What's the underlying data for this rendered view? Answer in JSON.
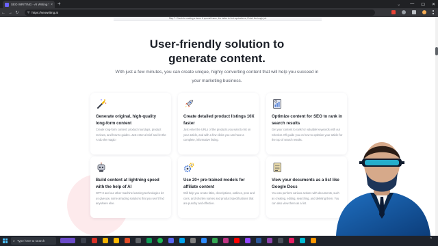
{
  "browser": {
    "tab_title": "SEO WRITING - AI Writing Tool",
    "tab_close": "×",
    "new_tab": "+",
    "window_controls": [
      "—",
      "▢",
      "✕"
    ],
    "dropdown": "⌄",
    "nav": {
      "back": "←",
      "forward": "→",
      "reload": "↻"
    },
    "lock": "⛨",
    "url": "https://seowriting.ai"
  },
  "page": {
    "caption_strip": "Step 7. Check for making a demo & special frame, the better to find equivalence, Finish the tough job",
    "headline_line1": "User-friendly solution to",
    "headline_line2": "generate content.",
    "subtext": "With just a few minutes, you can create unique, highly converting content that will help you succeed in your marketing business."
  },
  "features": [
    {
      "icon": "magic-wand-icon",
      "title": "Generate original, high-quality long-form content",
      "desc": "Create long-form content: product roundups, product reviews, and how-to guides. Just enter a brief and let the AI do the magic!"
    },
    {
      "icon": "rocket-icon",
      "title": "Create detailed product listings 10X faster",
      "desc": "Just enter the URLs of the products you want to list on your article, and with a few clicks you can have a complete, informative listing."
    },
    {
      "icon": "seo-analytics-icon",
      "title": "Optimize content for SEO to rank in search results",
      "desc": "Get your content to rank for valuable keywords with our Checker. It'll guide you on how to optimize your article for the top of search results."
    },
    {
      "icon": "robot-icon",
      "title": "Build content at lightning speed with the help of AI",
      "desc": "GPT-3 and our other machine learning technologies let us give you some amazing solutions that you won't find anywhere else."
    },
    {
      "icon": "gears-icon",
      "title": "Use 20+ pre-trained models for affiliate content",
      "desc": "Will help you create titles, descriptions, outlines, pros and cons, and shorten names and product specifications that are punchy and effective."
    },
    {
      "icon": "document-list-icon",
      "title": "View your documents as a list like Google Docs",
      "desc": "You can perform various actions with documents, such as creating, editing, searching, and deleting them. You can also view them as a list."
    }
  ],
  "taskbar": {
    "search_placeholder": "Type here to search",
    "search_icon": "⌕",
    "tray_chevron": "^",
    "tray_time": "",
    "tray_date": ""
  },
  "colors": {
    "accent": "#6c63ff",
    "headline": "#1b1f27",
    "body_text": "#5a5f6b",
    "desc_text": "#8a8f99",
    "blob": "#fde8ea"
  }
}
